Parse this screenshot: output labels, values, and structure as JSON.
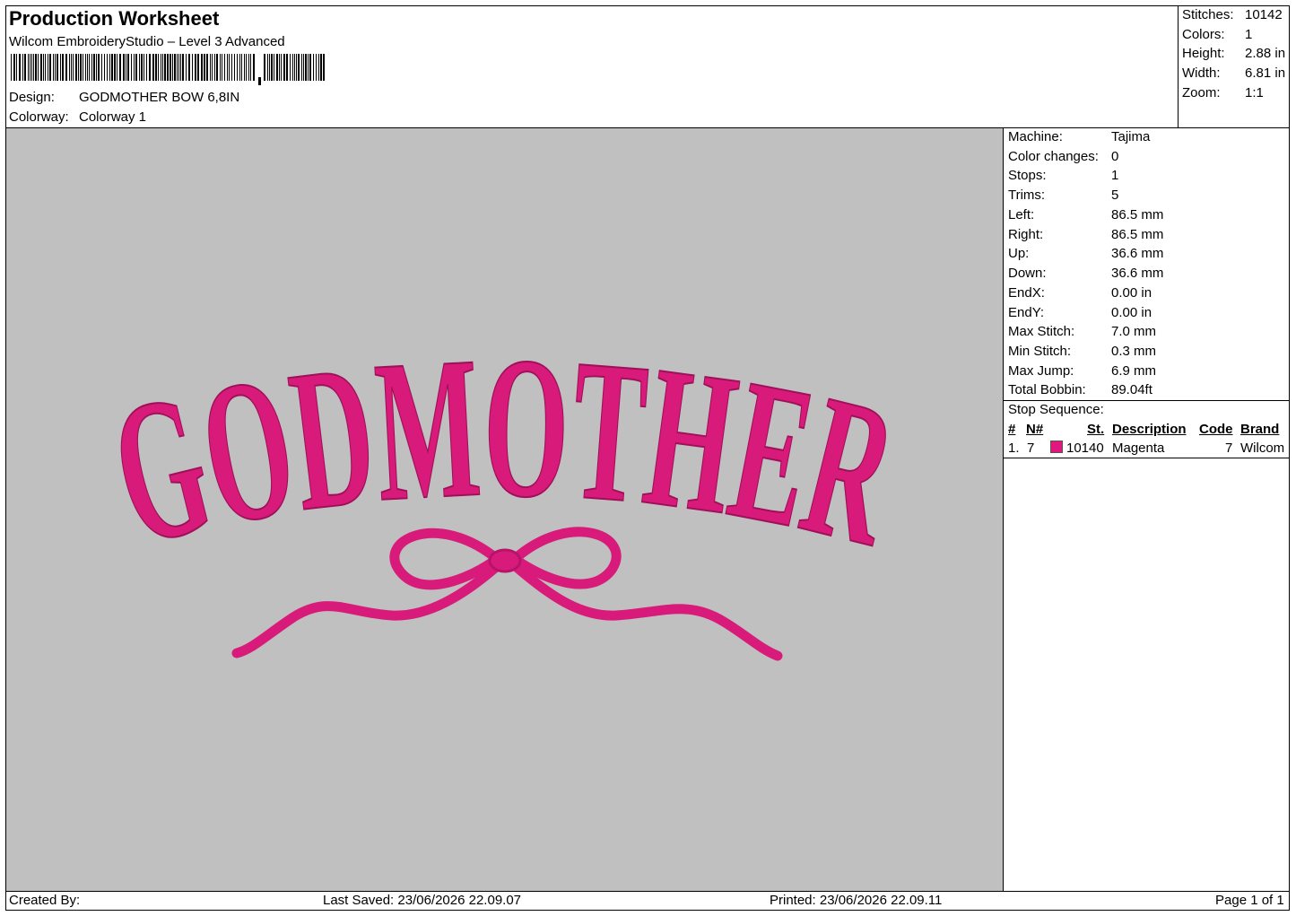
{
  "header": {
    "title": "Production Worksheet",
    "software": "Wilcom EmbroideryStudio – Level 3 Advanced",
    "design_label": "Design:",
    "design_value": "GODMOTHER BOW 6,8IN",
    "colorway_label": "Colorway:",
    "colorway_value": "Colorway 1"
  },
  "stats": [
    {
      "label": "Stitches:",
      "value": "10142"
    },
    {
      "label": "Colors:",
      "value": "1"
    },
    {
      "label": "Height:",
      "value": "2.88 in"
    },
    {
      "label": "Width:",
      "value": "6.81 in"
    },
    {
      "label": "Zoom:",
      "value": "1:1"
    }
  ],
  "design_preview": {
    "background": "#c0c0c0",
    "thread_color": "#d81b7a",
    "text": "GODMOTHER",
    "motif_icon": "bow-icon"
  },
  "machine_info": [
    {
      "label": "Machine:",
      "value": "Tajima"
    },
    {
      "label": "Color changes:",
      "value": "0"
    },
    {
      "label": "Stops:",
      "value": "1"
    },
    {
      "label": "Trims:",
      "value": "5"
    },
    {
      "label": "Left:",
      "value": "86.5 mm"
    },
    {
      "label": "Right:",
      "value": "86.5 mm"
    },
    {
      "label": "Up:",
      "value": "36.6 mm"
    },
    {
      "label": "Down:",
      "value": "36.6 mm"
    },
    {
      "label": "EndX:",
      "value": "0.00 in"
    },
    {
      "label": "EndY:",
      "value": "0.00 in"
    },
    {
      "label": "Max Stitch:",
      "value": "7.0 mm"
    },
    {
      "label": "Min Stitch:",
      "value": "0.3 mm"
    },
    {
      "label": "Max Jump:",
      "value": "6.9 mm"
    },
    {
      "label": "Total Bobbin:",
      "value": "89.04ft"
    }
  ],
  "stop_sequence": {
    "title": "Stop Sequence:",
    "headers": {
      "num": "#",
      "needle": "N#",
      "stitches": "St.",
      "description": "Description",
      "code": "Code",
      "brand": "Brand"
    },
    "rows": [
      {
        "num": "1.",
        "needle": "7",
        "swatch_color": "#e0187d",
        "stitches": "10140",
        "description": "Magenta",
        "code": "7",
        "brand": "Wilcom"
      }
    ]
  },
  "footer": {
    "created_by": "Created By:",
    "last_saved": "Last Saved: 23/06/2026 22.09.07",
    "printed": "Printed: 23/06/2026 22.09.11",
    "page": "Page 1 of 1"
  }
}
